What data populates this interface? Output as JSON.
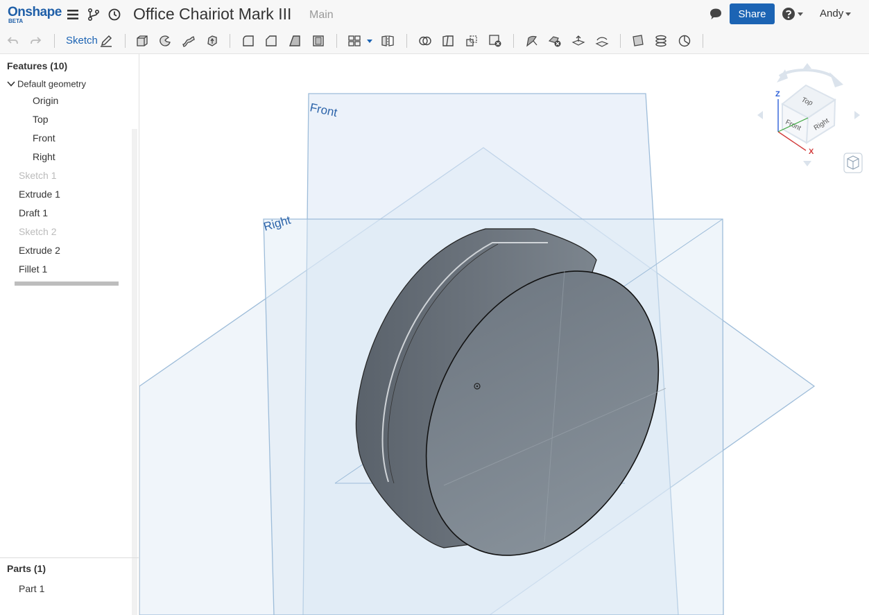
{
  "app": {
    "logo": "Onshape",
    "logo_badge": "BETA",
    "document_title": "Office Chairiot Mark III",
    "workspace": "Main",
    "share_label": "Share",
    "user_name": "Andy"
  },
  "toolbar": {
    "sketch_label": "Sketch"
  },
  "features": {
    "title": "Features (10)",
    "default_geometry_label": "Default geometry",
    "default_items": [
      "Origin",
      "Top",
      "Front",
      "Right"
    ],
    "items": [
      {
        "label": "Sketch 1",
        "state": "dimmed"
      },
      {
        "label": "Extrude 1",
        "state": "active"
      },
      {
        "label": "Draft 1",
        "state": "active"
      },
      {
        "label": "Sketch 2",
        "state": "dimmed"
      },
      {
        "label": "Extrude 2",
        "state": "active"
      },
      {
        "label": "Fillet 1",
        "state": "active"
      }
    ]
  },
  "parts": {
    "title": "Parts (1)",
    "items": [
      "Part 1"
    ]
  },
  "viewport": {
    "plane_labels": {
      "front": "Front",
      "right": "Right"
    },
    "view_cube": {
      "top": "Top",
      "front": "Front",
      "right": "Right",
      "axis_z": "Z",
      "axis_x": "X"
    },
    "colors": {
      "plane_fill": "#dce8f5",
      "plane_edge": "#9dbcd9",
      "plane_label": "#2b63a9",
      "part": "#76818b"
    }
  },
  "icons": [
    "menu-icon",
    "branch-icon",
    "history-icon",
    "comment-icon",
    "help-icon",
    "undo-icon",
    "redo-icon",
    "sketch-pencil-icon",
    "extrude-icon",
    "revolve-icon",
    "sweep-icon",
    "loft-icon",
    "fillet-icon",
    "chamfer-icon",
    "draft-icon",
    "shell-icon",
    "pattern-icon",
    "mirror-icon",
    "boolean-icon",
    "split-icon",
    "transform-icon",
    "delete-part-icon",
    "modify-fillet-icon",
    "delete-face-icon",
    "move-face-icon",
    "replace-face-icon",
    "plane-icon",
    "helix-icon",
    "mate-connector-icon",
    "view-cube-icon"
  ]
}
